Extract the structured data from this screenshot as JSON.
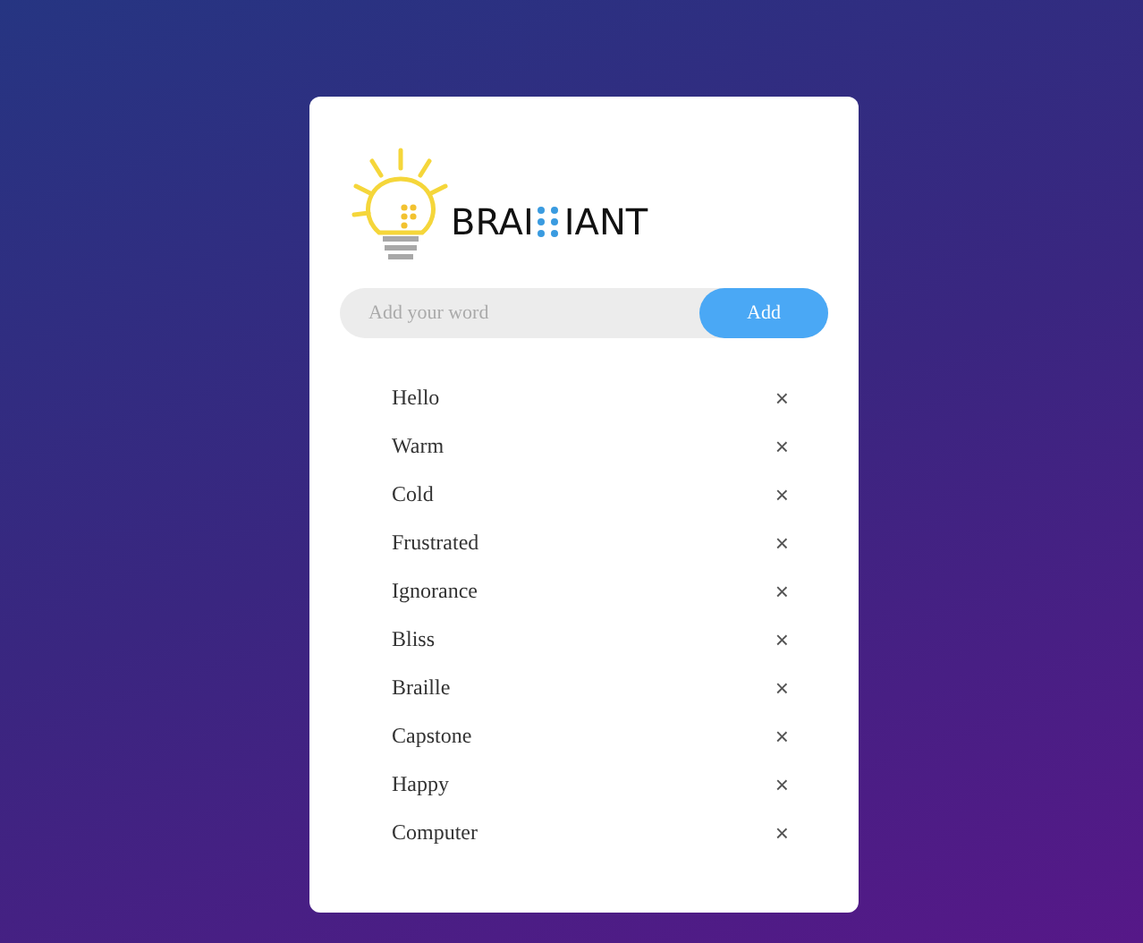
{
  "logo": {
    "text_start": "BRAI",
    "text_end": "IANT"
  },
  "search": {
    "placeholder": "Add your word",
    "button": "Add"
  },
  "words": [
    {
      "label": "Hello",
      "remove": "×"
    },
    {
      "label": "Warm",
      "remove": "×"
    },
    {
      "label": "Cold",
      "remove": "×"
    },
    {
      "label": "Frustrated",
      "remove": "×"
    },
    {
      "label": "Ignorance",
      "remove": "×"
    },
    {
      "label": "Bliss",
      "remove": "×"
    },
    {
      "label": "Braille",
      "remove": "×"
    },
    {
      "label": "Capstone",
      "remove": "×"
    },
    {
      "label": "Happy",
      "remove": "×"
    },
    {
      "label": "Computer",
      "remove": "×"
    }
  ]
}
